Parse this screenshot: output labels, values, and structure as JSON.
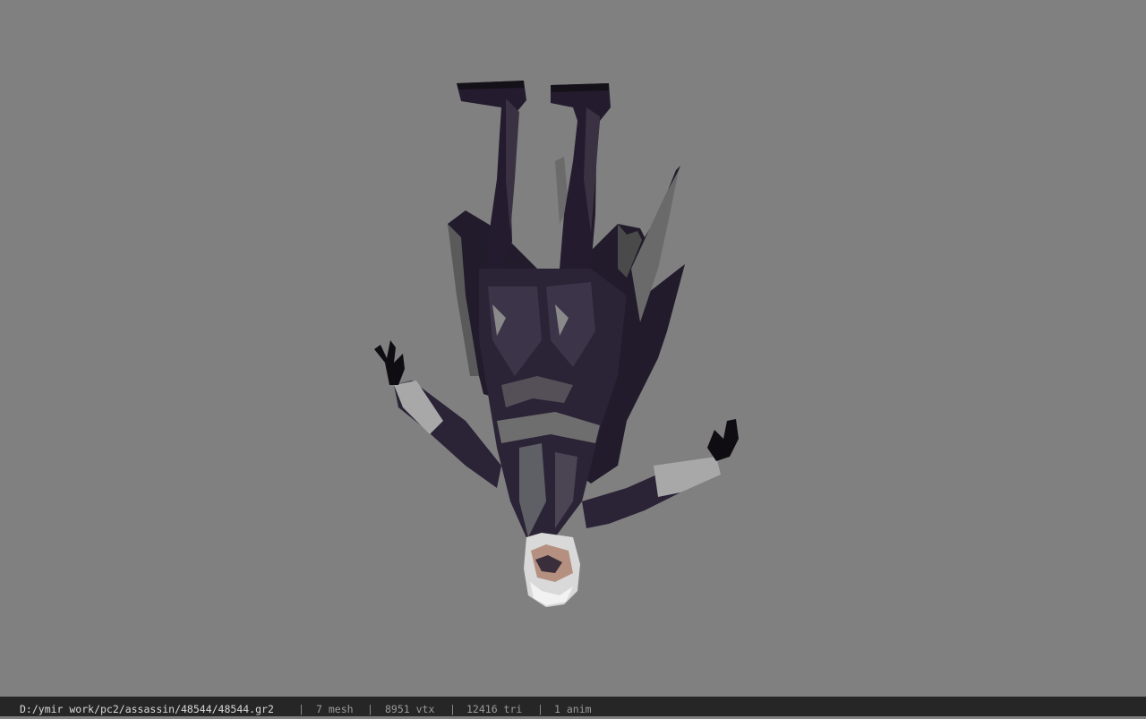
{
  "viewer": {
    "background_color": "#808080",
    "model_icon": "upside-down-assassin-character-model"
  },
  "status_bar": {
    "file_path": "D:/ymir work/pc2/assassin/48544/48544.gr2",
    "separator": "|",
    "mesh_count": "7 mesh",
    "vertex_count": "8951 vtx",
    "triangle_count": "12416 tri",
    "anim_count": "1 anim"
  }
}
